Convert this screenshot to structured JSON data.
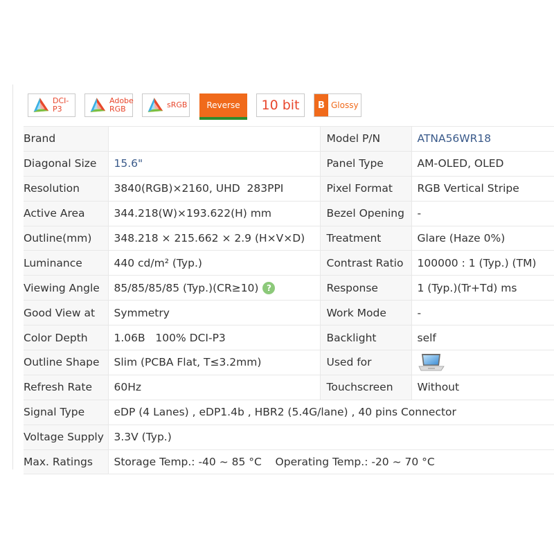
{
  "badges": {
    "dci": "DCI-P3",
    "adobe_line1": "Adobe",
    "adobe_line2": "RGB",
    "srgb": "sRGB",
    "reverse": "Reverse",
    "bit": "10 bit",
    "glossy_mark": "B",
    "glossy": "Glossy"
  },
  "specs": {
    "brand_label": "Brand",
    "brand_value": "",
    "model_label": "Model P/N",
    "model_value": "ATNA56WR18",
    "diagonal_label": "Diagonal Size",
    "diagonal_value": "15.6\"",
    "panel_type_label": "Panel Type",
    "panel_type_value": "AM-OLED, OLED",
    "resolution_label": "Resolution",
    "resolution_value": "3840(RGB)×2160, UHD  283PPI",
    "pixel_format_label": "Pixel Format",
    "pixel_format_value": "RGB Vertical Stripe",
    "active_area_label": "Active Area",
    "active_area_value": "344.218(W)×193.622(H) mm",
    "bezel_label": "Bezel Opening",
    "bezel_value": "-",
    "outline_label": "Outline(mm)",
    "outline_value": "348.218 × 215.662 × 2.9 (H×V×D)",
    "treatment_label": "Treatment",
    "treatment_value": "Glare (Haze 0%)",
    "luminance_label": "Luminance",
    "luminance_value": "440 cd/m² (Typ.)",
    "contrast_label": "Contrast Ratio",
    "contrast_value": "100000 : 1 (Typ.) (TM)",
    "viewing_label": "Viewing Angle",
    "viewing_value": "85/85/85/85 (Typ.)(CR≥10)",
    "viewing_help": "?",
    "response_label": "Response",
    "response_value": "1 (Typ.)(Tr+Td) ms",
    "good_view_label": "Good View at",
    "good_view_value": "Symmetry",
    "work_mode_label": "Work Mode",
    "work_mode_value": "-",
    "color_depth_label": "Color Depth",
    "color_depth_value": "1.06B   100% DCI-P3",
    "backlight_label": "Backlight",
    "backlight_value": "self",
    "outline_shape_label": "Outline Shape",
    "outline_shape_value": "Slim (PCBA Flat, T≤3.2mm)",
    "used_for_label": "Used for",
    "used_for_icon": "laptop-icon",
    "refresh_label": "Refresh Rate",
    "refresh_value": "60Hz",
    "touch_label": "Touchscreen",
    "touch_value": "Without",
    "signal_label": "Signal Type",
    "signal_value": "eDP (4 Lanes) , eDP1.4b , HBR2 (5.4G/lane) , 40 pins Connector",
    "voltage_label": "Voltage Supply",
    "voltage_value": "3.3V (Typ.)",
    "max_label": "Max. Ratings",
    "max_value": "Storage Temp.: -40 ~ 85 °C    Operating Temp.: -20 ~ 70 °C"
  },
  "colors": {
    "link": "#3a5a8a",
    "badge_orange": "#f06a1b",
    "badge_red_text": "#e8472d",
    "label_bg": "#f7f7f7"
  }
}
